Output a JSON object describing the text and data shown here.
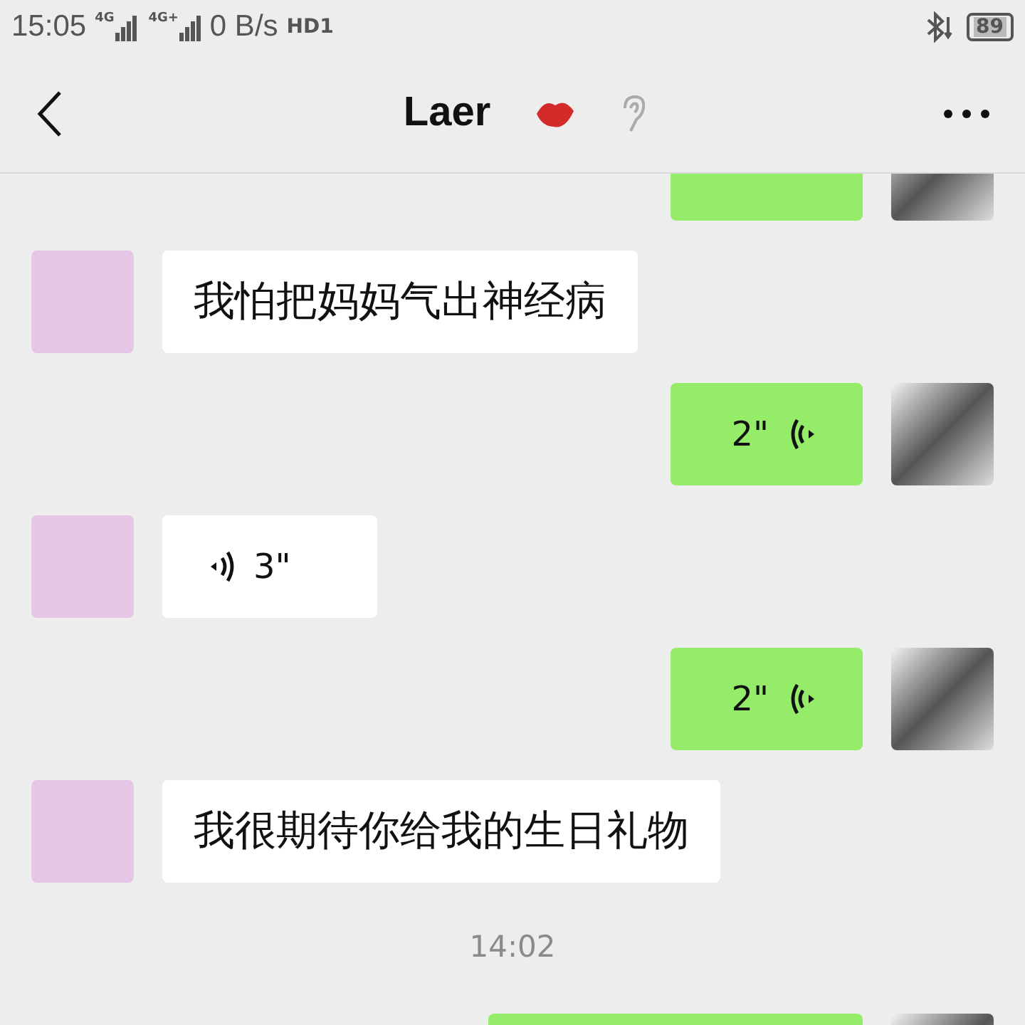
{
  "status_bar": {
    "time": "15:05",
    "sim1": "4G",
    "sim2": "4G+",
    "speed": "0 B/s",
    "hd": "HD1",
    "battery": "89"
  },
  "header": {
    "title": "Laer"
  },
  "messages": [
    {
      "kind": "stub",
      "outgoing": true
    },
    {
      "kind": "text",
      "outgoing": false,
      "text": "我怕把妈妈气出神经病"
    },
    {
      "kind": "voice",
      "outgoing": true,
      "duration": "2\""
    },
    {
      "kind": "voice",
      "outgoing": false,
      "duration": "3\""
    },
    {
      "kind": "voice",
      "outgoing": true,
      "duration": "2\""
    },
    {
      "kind": "text",
      "outgoing": false,
      "text": "我很期待你给我的生日礼物"
    },
    {
      "kind": "time",
      "text": "14:02"
    },
    {
      "kind": "stub",
      "outgoing": true
    }
  ]
}
